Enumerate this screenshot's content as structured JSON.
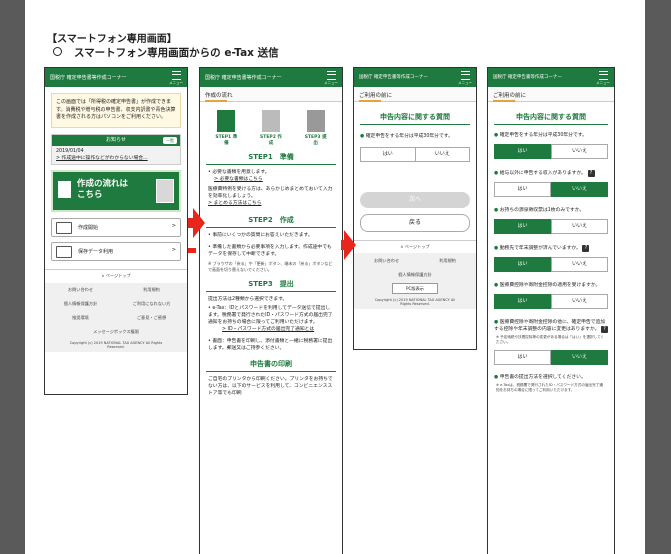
{
  "doc": {
    "heading": "【スマートフォン専用画面】",
    "subheading": "スマートフォン専用画面からの e-Tax 送信"
  },
  "phone1": {
    "title": "国税庁 確定申告書等作成コーナー",
    "menu": "メニュー",
    "intro": "この画面では「所得税の確定申告書」が作成できます。消費税や贈与税の申告書、収支内訳書や青色決算書を作成される方はパソコンをご利用ください。",
    "notice_label": "お知らせ",
    "notice_btn": "一覧",
    "notice_date": "2019/01/04",
    "notice_text": "作成途中に操作などがわからない場合...",
    "banner_line1": "作成の流れは",
    "banner_line2": "こちら",
    "action_create": "作成開始",
    "action_load": "保存データ利用",
    "pagetop": "ページトップ",
    "links": [
      "お問い合わせ",
      "利用規約",
      "個人情報保護方針",
      "ご利用になれない方",
      "推奨環境",
      "ご意見・ご感想"
    ],
    "sitemap": "メッセージボックス権限",
    "copyright": "Copyright (c) 2019 NATIONAL TAX AGENCY All Rights Reserved."
  },
  "phone2": {
    "title": "国税庁 確定申告書等作成コーナー",
    "menu": "メニュー",
    "sub": "作成の流れ",
    "steps": [
      "STEP1 準備",
      "STEP2 作成",
      "STEP3 提出"
    ],
    "s1_title": "STEP1　準備",
    "s1_b1": "必要な書類を用意します。",
    "s1_l1": "必要な書類はこちら",
    "s1_p": "医療費特例を受ける方は、あらかじめまとめておいて入力を効率化しましょう。",
    "s1_l2": "まとめる方法はこちら",
    "s2_title": "STEP2　作成",
    "s2_b1": "事前にいくつかの質問にお答えいただきます。",
    "s2_b2": "準備した書類から必要事項を入力します。作成途中でもデータを保存して中断できます。",
    "s2_note": "※ ブラウザの「戻る」や「更新」ボタン、端末の「戻る」ボタンなどで画面を切り替えないでください。",
    "s3_title": "STEP3　提出",
    "s3_p": "提出方法は2種類から選択できます。",
    "s3_etax": "e-Tax：IDとパスワードを利用してデータ送信で提出します。税務署で発行されたID・パスワード方式の届出完了通知をお持ちの場合に限ってご利用いただけます。",
    "s3_link": "ID・パスワード方式の届出完了通知とは",
    "s3_paper": "書面：申告書を印刷し、添付書類と一緒に税務署に提出します。郵送又はご持参ください。",
    "print_title": "申告書の印刷",
    "print_p": "ご自宅のプリンタから印刷ください。プリンタをお持ちでない方は、以下のサービスを利用して、コンビニエンスストア等でも印刷"
  },
  "phone3": {
    "title": "国税庁 確定申告書等作成コーナー",
    "menu": "メニュー",
    "sub": "ご利用の前に",
    "h": "申告内容に関する質問",
    "q1": "確定申告をする年分は平成30年分です。",
    "yes": "はい",
    "no": "いいえ",
    "next": "次へ",
    "back": "戻る",
    "pagetop": "ページトップ",
    "links": [
      "お問い合わせ",
      "利用規約"
    ],
    "privacy": "個人情報保護方針",
    "pc": "PC版表示",
    "copyright": "Copyright (c) 2019 NATIONAL TAX AGENCY All Rights Reserved."
  },
  "phone4": {
    "title": "国税庁 確定申告書等作成コーナー",
    "menu": "メニュー",
    "sub": "ご利用の前に",
    "h": "申告内容に関する質問",
    "yes": "はい",
    "no": "いいえ",
    "q1": "確定申告をする年分は平成30年分です。",
    "q2": "給与以外に申告する収入がありますか。",
    "q3": "お持ちの源泉徴収票は1枚のみですか。",
    "q4": "勤務先で年末調整が済んでいますか。",
    "q5": "医療費控除や寄附金控除の適用を受けますか。",
    "q6": "医療費控除や寄附金控除の他に、確定申告で追加する控除や年末調整の内容に変更はありますか。",
    "q6_note": "※ 予定納税や扶養控除等の変更がある場合は「はい」を選択してください。",
    "q7": "申告書の提出方法を選択してください。",
    "q7_note": "※ e-Taxは、税務署で発行されたID・パスワード方式の届出完了通知をお持ちの場合に限ってご利用いただけます。"
  }
}
